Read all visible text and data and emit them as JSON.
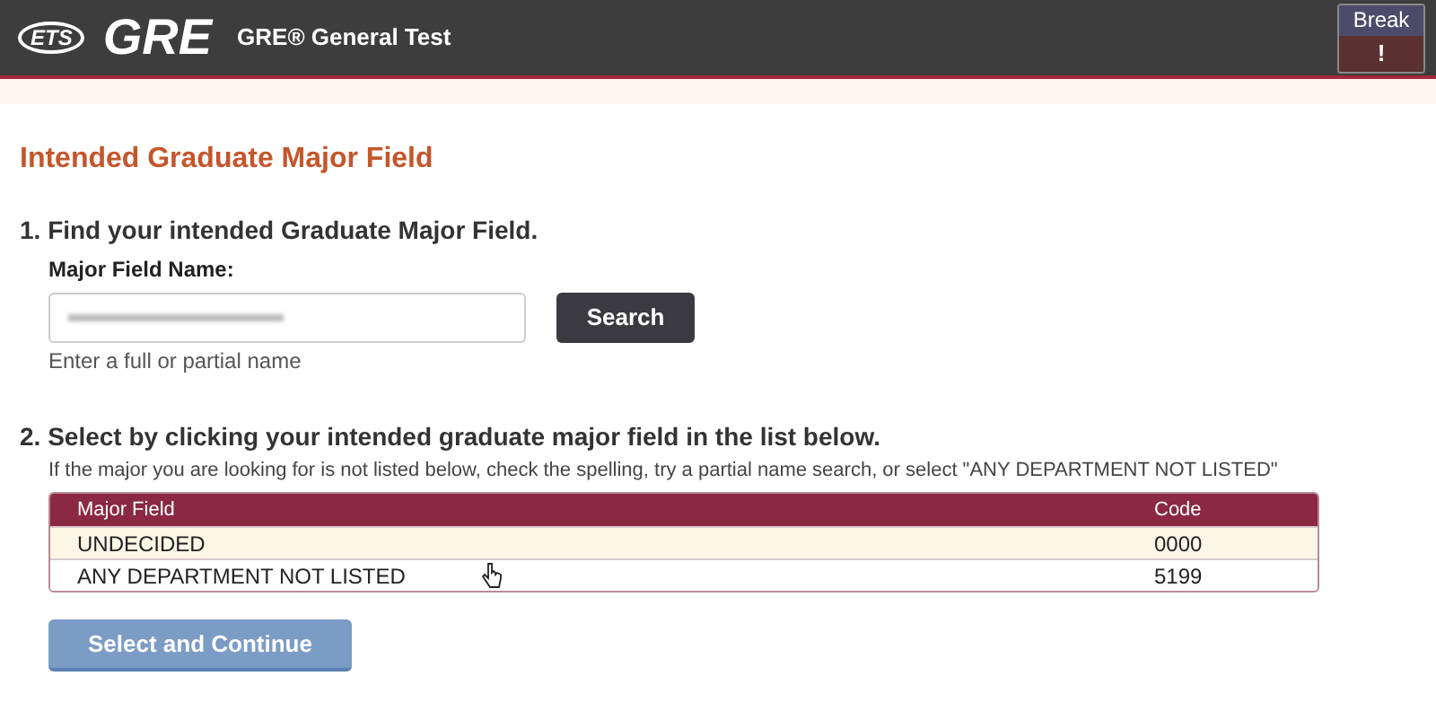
{
  "header": {
    "logo": "ETS",
    "product": "GRE",
    "title": "GRE® General Test",
    "break_button": "Break",
    "break_icon": "!"
  },
  "page_title": "Intended Graduate Major Field",
  "step_1": {
    "heading": "1. Find your intended Graduate Major Field.",
    "label": "Major Field Name:",
    "hint": "Enter a full or partial name",
    "search_button": "Search"
  },
  "step_2": {
    "heading": "2. Select by clicking your intended graduate major field in the list below.",
    "note": "If the major you are looking for is not listed below, check the spelling, try a partial name search, or select \"ANY DEPARTMENT NOT LISTED\""
  },
  "table": {
    "columns": [
      "Major Field",
      "Code"
    ],
    "rows": [
      {
        "cells": [
          "UNDECIDED",
          "0000"
        ],
        "selected": false
      },
      {
        "cells": [
          "ANY DEPARTMENT NOT LISTED",
          "5199"
        ],
        "selected": false
      }
    ]
  },
  "continue_button": {
    "label": "Select and Continue",
    "disabled": true
  }
}
